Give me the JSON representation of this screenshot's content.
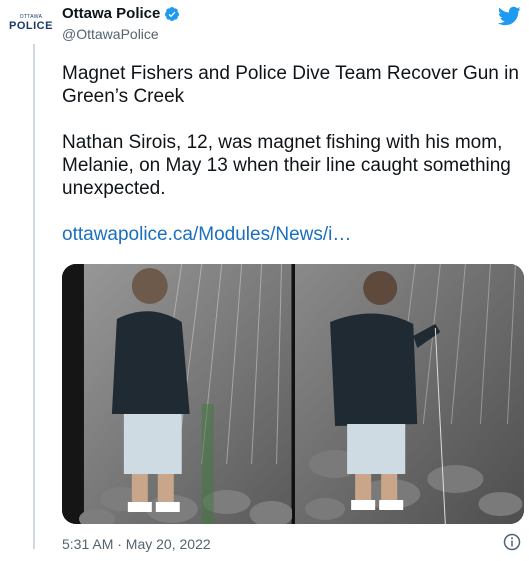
{
  "account": {
    "avatar_city": "OTTAWA",
    "avatar_word": "POLICE",
    "display_name": "Ottawa Police",
    "handle": "@OttawaPolice",
    "verified": true
  },
  "tweet": {
    "headline": "Magnet Fishers and Police Dive Team Recover Gun in Green’s Creek",
    "body": "Nathan Sirois, 12, was magnet fishing with his mom, Melanie, on May 13 when their line caught something unexpected.",
    "link": "ottawapolice.ca/Modules/News/i…"
  },
  "timestamp": "5:31 AM · May 20, 2022",
  "icons": {
    "brand": "twitter-bird-icon",
    "verified": "verified-badge-icon",
    "info": "info-icon"
  },
  "colors": {
    "link": "#1b6fbf",
    "twitter_blue": "#1d9bf0",
    "police_navy": "#1a3a6b"
  }
}
